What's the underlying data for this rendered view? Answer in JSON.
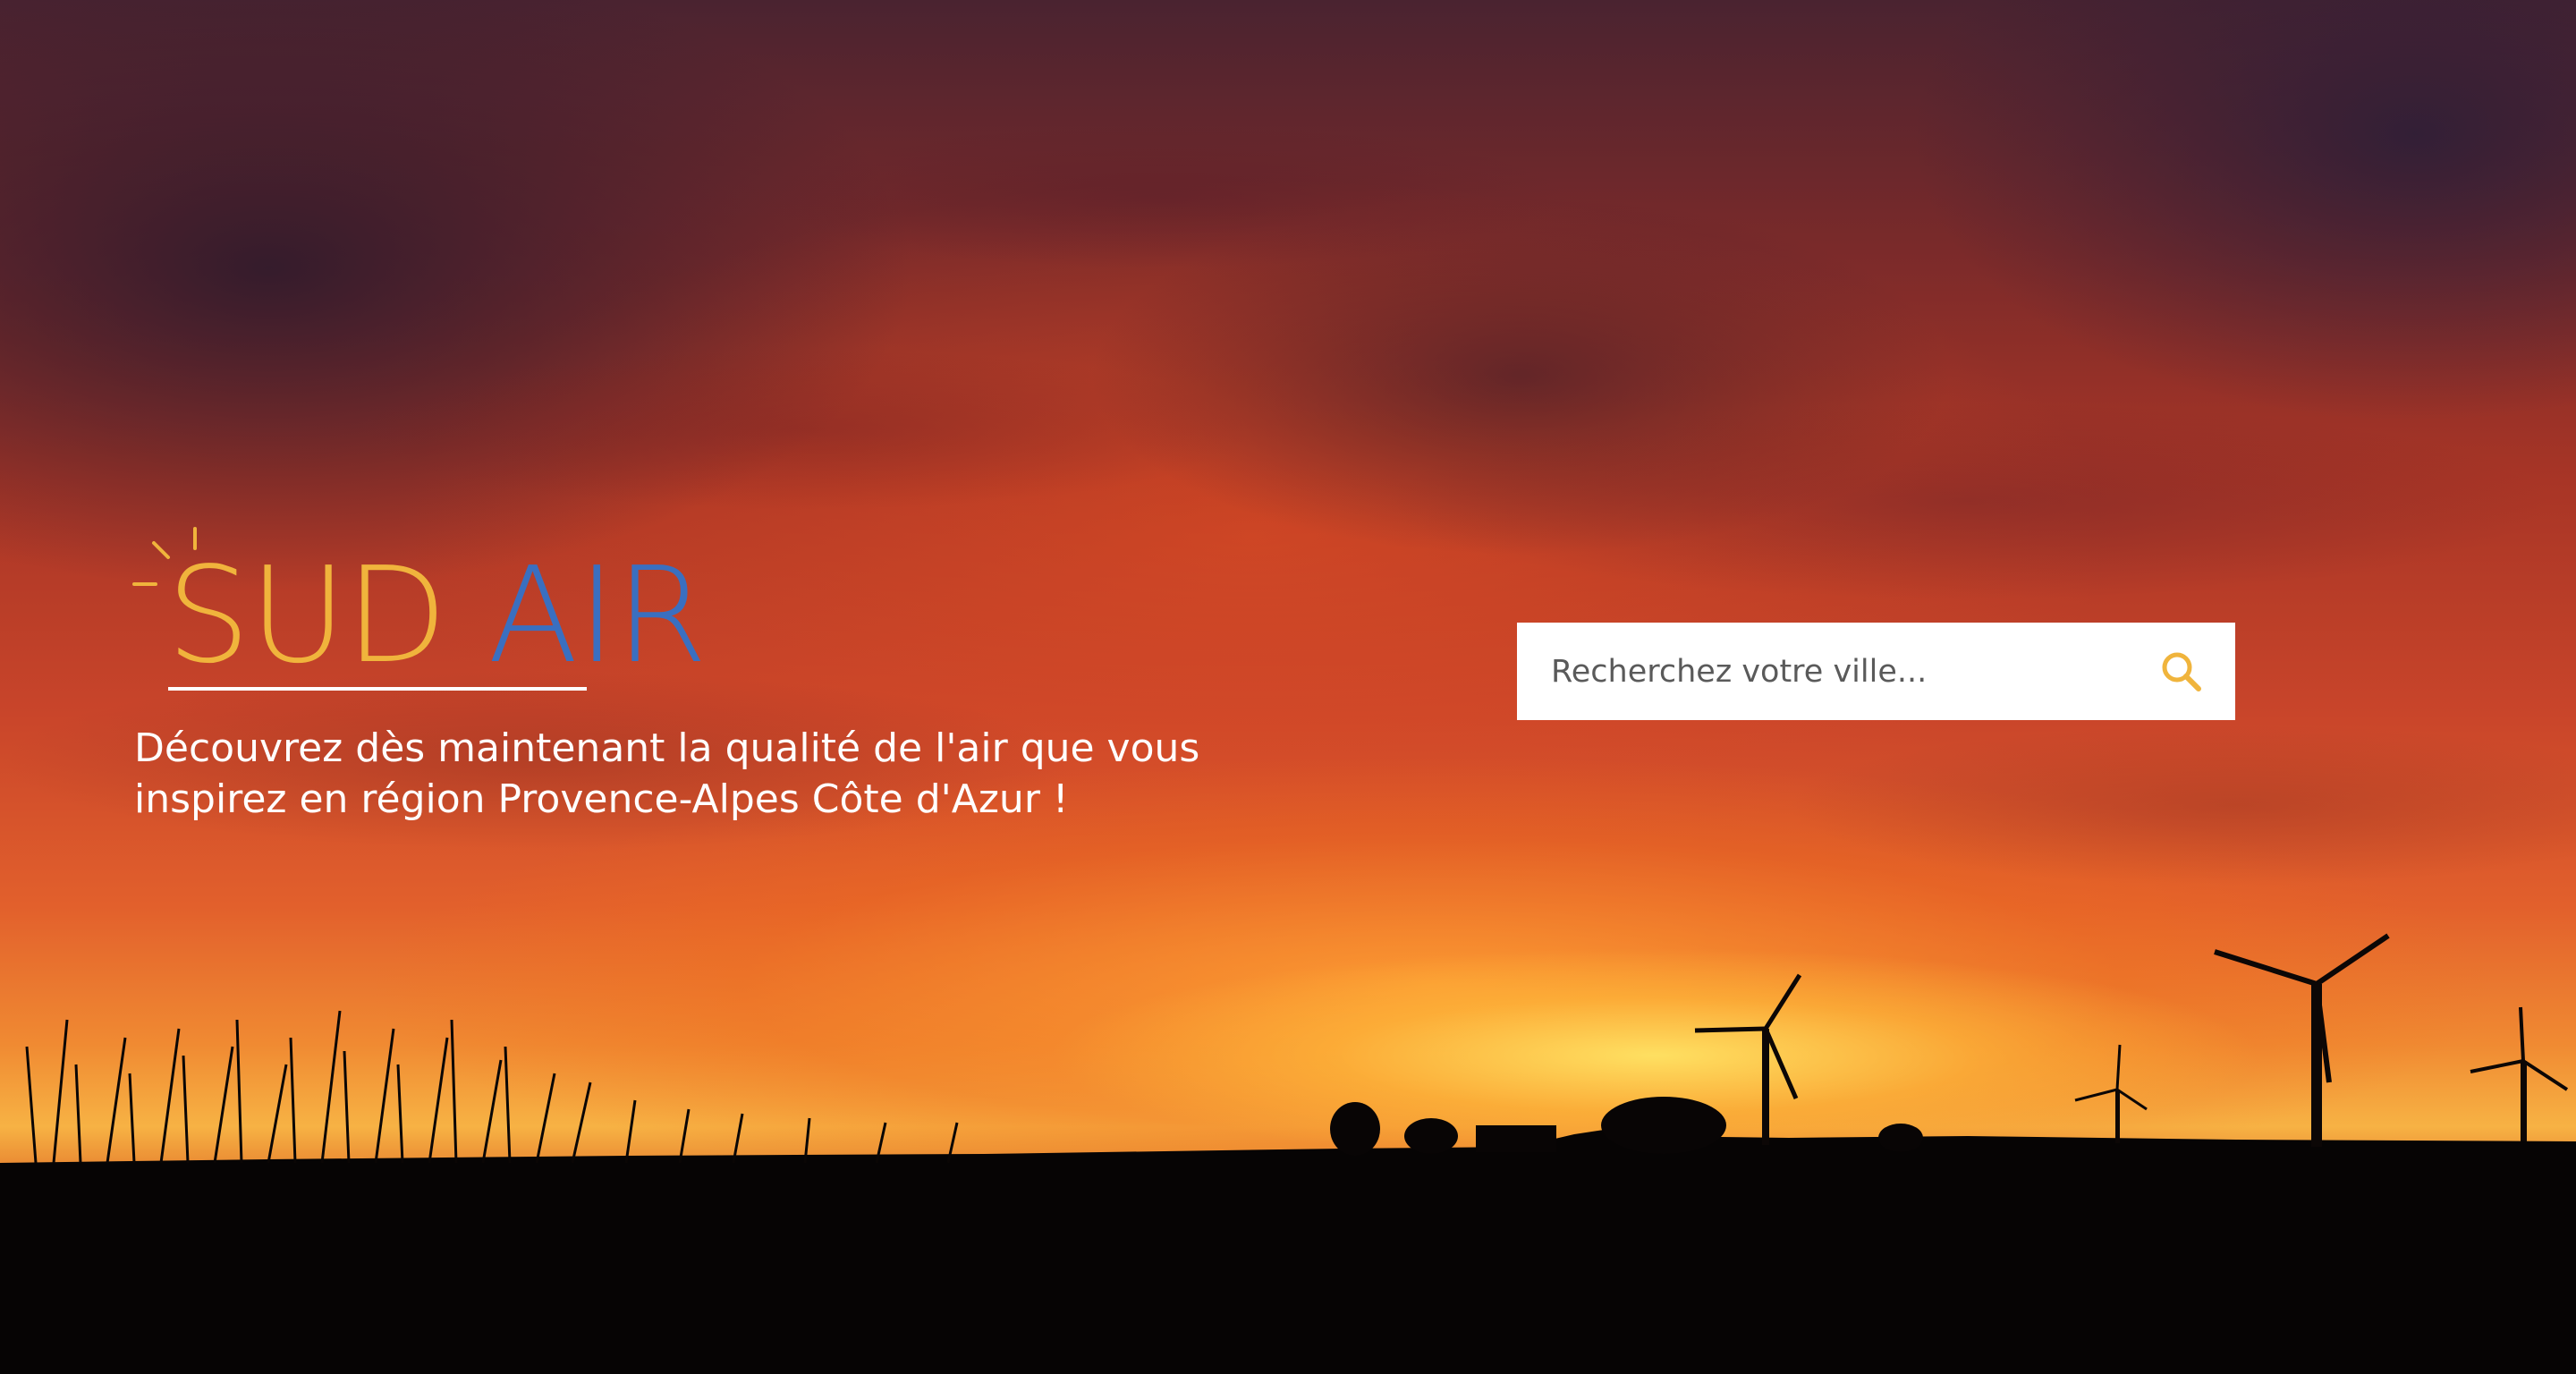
{
  "brand": {
    "part1": "SUD",
    "part2": "AIR",
    "accent_color": "#f0b43c",
    "secondary_color": "#3a6fc0"
  },
  "hero": {
    "tagline_line1": "Découvrez dès maintenant la qualité de l'air que vous",
    "tagline_line2": "inspirez en région Provence-Alpes Côte d'Azur !"
  },
  "search": {
    "placeholder": "Recherchez votre ville...",
    "value": "",
    "icon": "search-icon"
  }
}
